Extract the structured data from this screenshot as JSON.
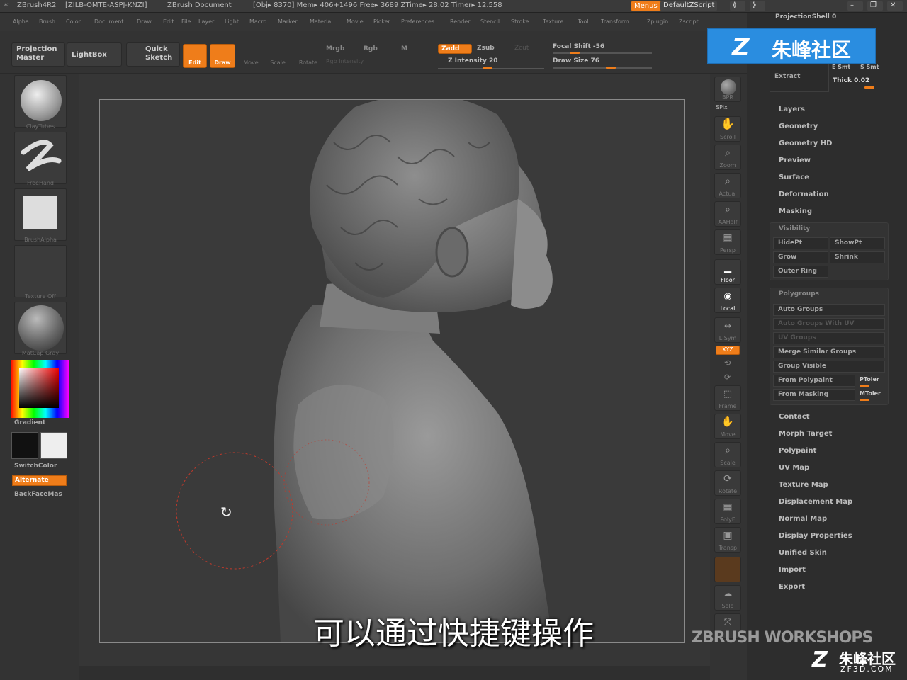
{
  "titlebar": {
    "app": "ZBrush4R2",
    "serial": "[ZILB-OMTE-ASPJ-KNZI]",
    "document": "ZBrush Document",
    "stats": "[Obj▸ 8370] Mem▸ 406+1496 Free▸ 3689 ZTime▸ 28.02 Timer▸ 12.558",
    "menus_btn": "Menus",
    "script_btn": "DefaultZScript"
  },
  "menubar": [
    "Alpha",
    "Brush",
    "Color",
    "Document",
    "Draw",
    "Edit",
    "File",
    "Layer",
    "Light",
    "Macro",
    "Marker",
    "Material",
    "Movie",
    "Picker",
    "Preferences",
    "Render",
    "Stencil",
    "Stroke",
    "Texture",
    "Tool",
    "Transform",
    "Zplugin",
    "Zscript"
  ],
  "shelf": {
    "projection_master": "Projection Master",
    "lightbox": "LightBox",
    "quick_sketch": "Quick Sketch",
    "edit": "Edit",
    "draw": "Draw",
    "move": "Move",
    "scale": "Scale",
    "rotate": "Rotate",
    "mrgb": "Mrgb",
    "rgb": "Rgb",
    "m": "M",
    "rgb_intensity": "Rgb Intensity",
    "zadd": "Zadd",
    "zsub": "Zsub",
    "zcut": "Zcut",
    "z_intensity": "Z Intensity 20",
    "focal_shift": "Focal Shift -56",
    "draw_size": "Draw Size 76"
  },
  "left": {
    "brush_label": "ClayTubes",
    "stroke_label": "FreeHand",
    "alpha_label": "BrushAlpha",
    "texture_label": "Texture Off",
    "material_label": "MatCap Gray",
    "gradient": "Gradient",
    "switch_color": "SwitchColor",
    "alternate": "Alternate",
    "backface": "BackFaceMas"
  },
  "righttools": [
    "BPR",
    "SPix",
    "Scroll",
    "Zoom",
    "Actual",
    "AAHalf",
    "Persp",
    "Floor",
    "Local",
    "L.Sym",
    "XYZ",
    "Frame",
    "Move",
    "Scale",
    "Rotate",
    "PolyF",
    "Transp",
    "Solo"
  ],
  "rightpanel": {
    "projection_shell": "ProjectionShell 0",
    "extract": "Extract",
    "e_smt": "E Smt",
    "s_smt": "S Smt",
    "thick": "Thick 0.02",
    "items_top": [
      "Layers",
      "Geometry",
      "Geometry HD",
      "Preview",
      "Surface",
      "Deformation",
      "Masking"
    ],
    "visibility": {
      "title": "Visibility",
      "hidept": "HidePt",
      "showpt": "ShowPt",
      "grow": "Grow",
      "shrink": "Shrink",
      "outer_ring": "Outer Ring"
    },
    "polygroups": {
      "title": "Polygroups",
      "auto_groups": "Auto Groups",
      "uv_groups": "Auto Groups With UV",
      "uv_groups2": "UV Groups",
      "merge": "Merge Similar Groups",
      "group_visible": "Group Visible",
      "from_polypaint": "From Polypaint",
      "ptoler": "PToler",
      "from_masking": "From Masking",
      "mtoler": "MToler"
    },
    "items_bottom": [
      "Contact",
      "Morph Target",
      "Polypaint",
      "UV Map",
      "Texture Map",
      "Displacement Map",
      "Normal Map",
      "Display Properties",
      "Unified Skin",
      "Import",
      "Export"
    ]
  },
  "subtitle": "可以通过快捷键操作",
  "watermark_top": "朱峰社区",
  "watermark_bottom_main": "ZBRUSH WORKSHOPS",
  "watermark_bottom_cn": "朱峰社区",
  "watermark_bottom_url": "ZF3D.COM"
}
